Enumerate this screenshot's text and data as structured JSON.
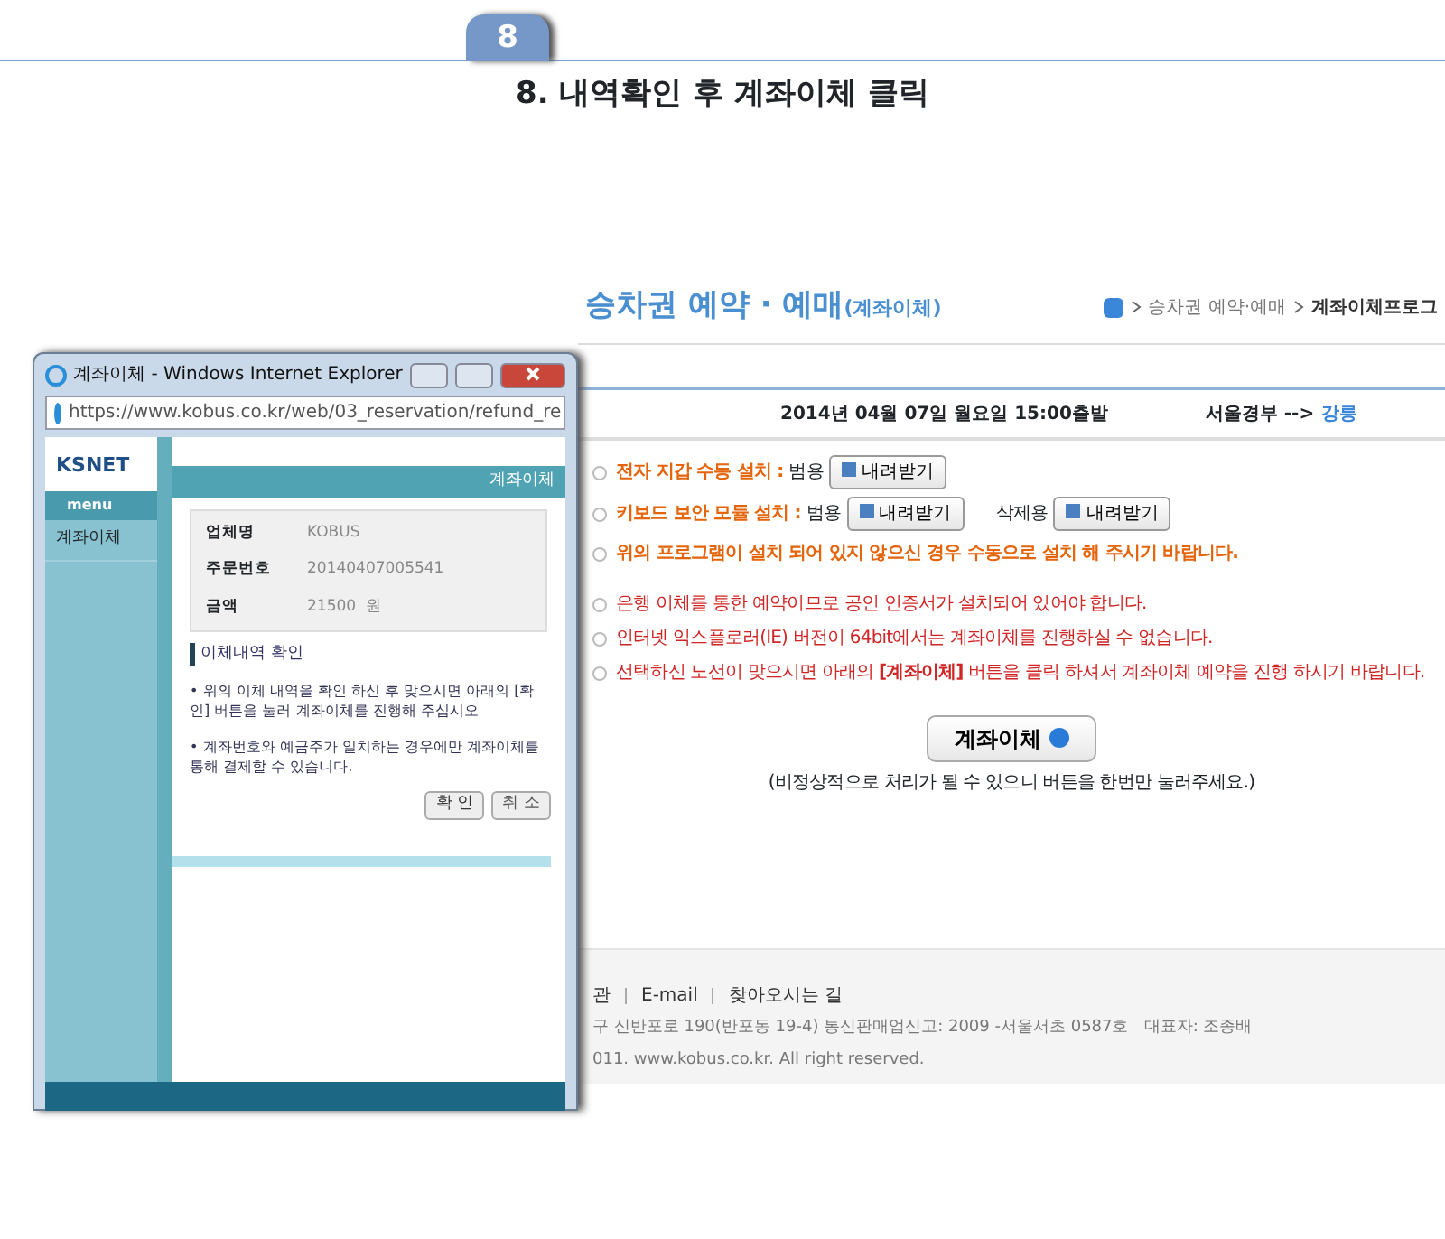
{
  "step_badge": "8",
  "heading": "8. 내역확인 후 계좌이체 클릭",
  "site": {
    "title": "승차권 예약 · 예매",
    "title_suffix": "(계좌이체)",
    "breadcrumb": [
      "승차권 예약·예매",
      "계좌이체프로그"
    ],
    "trip": {
      "date": "2014년 04월 07일 월요일 15:00출발",
      "origin": "서울경부 -->",
      "destination": "강릉"
    },
    "install_items": [
      {
        "label": "전자 지갑 수동 설치 :",
        "downloads": [
          {
            "prefix": "범용",
            "button": "내려받기"
          }
        ]
      },
      {
        "label": "키보드 보안 모듈 설치 :",
        "downloads": [
          {
            "prefix": "범용",
            "button": "내려받기"
          },
          {
            "prefix": "삭제용",
            "button": "내려받기"
          }
        ]
      },
      {
        "label": "위의 프로그램이 설치 되어 있지 않으신 경우 수동으로 설치 해 주시기 바랍니다."
      }
    ],
    "notices": [
      "은행 이체를 통한 예약이므로 공인 인증서가 설치되어 있어야 합니다.",
      "인터넷 익스플로러(IE) 버전이 64bit에서는 계좌이체를 진행하실 수 없습니다.",
      "선택하신 노선이 맞으시면 아래의 **[계좌이체]** 버튼을 클릭 하셔서 계좌이체 예약을 진행 하시기 바랍니다."
    ],
    "transfer_button": "계좌이체",
    "transfer_note": "(비정상적으로 처리가 될 수 있으니 버튼을 한번만 눌러주세요.)",
    "footer": {
      "links": [
        "관",
        "E-mail",
        "찾아오시는 길"
      ],
      "lines": [
        "구 신반포로 190(반포동 19-4) 통신판매업신고: 2009 -서울서초 0587호   대표자: 조종배",
        "011. www.kobus.co.kr. All right reserved."
      ]
    }
  },
  "popup": {
    "window_title": "계좌이체 - Windows Internet Explorer",
    "url": "https://www.kobus.co.kr/web/03_reservation/refund_re",
    "logo": "KSNET",
    "menu_label": "menu",
    "menu_items": [
      "계좌이체"
    ],
    "header": "계좌이체",
    "info": [
      {
        "label": "업체명",
        "value": "KOBUS"
      },
      {
        "label": "주문번호",
        "value": "20140407005541"
      },
      {
        "label": "금액",
        "value": "21500  원"
      }
    ],
    "section_title": "이체내역 확인",
    "paragraphs": [
      "• 위의 이체 내역을 확인 하신 후 맞으시면 아래의 [확인] 버튼을 눌러 계좌이체를 진행해 주십시오",
      "• 계좌번호와 예금주가 일치하는 경우에만 계좌이체를 통해 결제할 수 있습니다."
    ],
    "buttons": [
      {
        "kind": "confirm",
        "label": "확 인"
      },
      {
        "kind": "cancel",
        "label": "취 소"
      }
    ]
  }
}
